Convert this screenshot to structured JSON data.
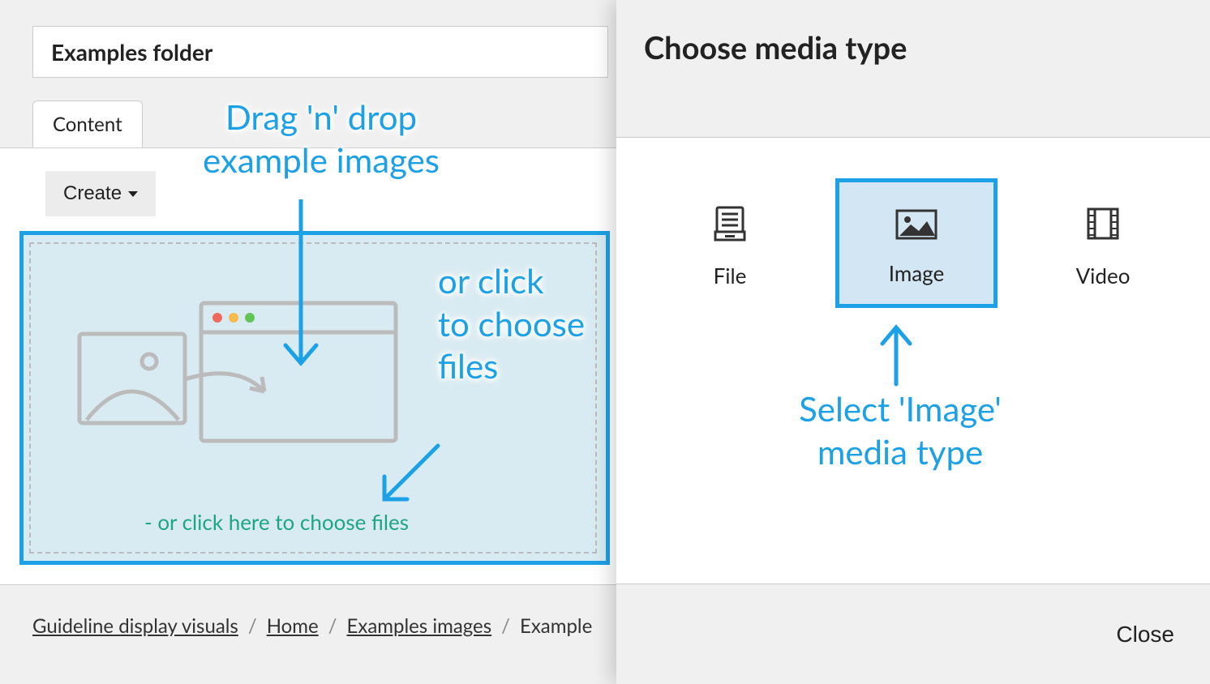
{
  "page": {
    "title": "Examples folder",
    "tab_content": "Content",
    "create_label": "Create",
    "dropzone_hint": "- or click here to choose files"
  },
  "breadcrumb": {
    "item1": "Guideline display visuals",
    "item2": "Home",
    "item3": "Examples images",
    "item4": "Example"
  },
  "annotations": {
    "drag_drop_line1": "Drag 'n' drop",
    "drag_drop_line2": "example images",
    "click_line1": "or click",
    "click_line2": "to choose",
    "click_line3": "files",
    "select_line1": "Select 'Image'",
    "select_line2": "media type"
  },
  "right": {
    "title": "Choose media type",
    "types": {
      "file": "File",
      "image": "Image",
      "video": "Video"
    },
    "close": "Close"
  }
}
